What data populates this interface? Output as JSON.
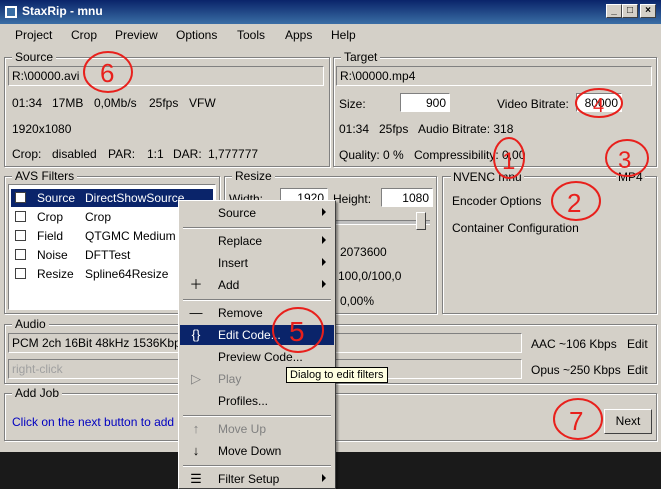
{
  "window": {
    "title": "StaxRip - mnu"
  },
  "menubar": {
    "items": [
      "Project",
      "Crop",
      "Preview",
      "Options",
      "Tools",
      "Apps",
      "Help"
    ]
  },
  "source": {
    "label": "Source",
    "path": "R:\\00000.avi",
    "info_line1": [
      "01:34",
      "17MB",
      "0,0Mb/s",
      "25fps",
      "VFW"
    ],
    "resolution": "1920x1080",
    "crop_label": "Crop:",
    "crop_value": "disabled",
    "par_label": "PAR:",
    "par_value": "1:1",
    "dar_label": "DAR:",
    "dar_value": "1,777777"
  },
  "target": {
    "label": "Target",
    "path": "R:\\00000.mp4",
    "size_label": "Size:",
    "size_value": "900",
    "video_bitrate_label": "Video Bitrate:",
    "video_bitrate_value": "80000",
    "duration": "01:34",
    "fps": "25fps",
    "audio_bitrate": "Audio Bitrate: 318",
    "quality": "Quality: 0 %",
    "compressibility": "Compressibility: 0,00"
  },
  "avs_filters": {
    "label": "AVS Filters",
    "rows": [
      {
        "category": "Source",
        "name": "DirectShowSource",
        "checked": true,
        "selected": true
      },
      {
        "category": "Crop",
        "name": "Crop",
        "checked": false,
        "selected": false
      },
      {
        "category": "Field",
        "name": "QTGMC Medium",
        "checked": false,
        "selected": false
      },
      {
        "category": "Noise",
        "name": "DFTTest",
        "checked": false,
        "selected": false
      },
      {
        "category": "Resize",
        "name": "Spline64Resize",
        "checked": false,
        "selected": false
      }
    ]
  },
  "resize": {
    "label": "Resize",
    "width_label": "Width:",
    "width_value": "1920",
    "height_label": "Height:",
    "height_value": "1080",
    "pixels": "2073600",
    "zoom": "100,0/100,0",
    "error": "0,00%"
  },
  "encoder": {
    "name": "NVENC mnu",
    "container": "MP4",
    "options_label": "Encoder Options",
    "container_config_label": "Container Configuration"
  },
  "audio": {
    "label": "Audio",
    "track1_value": "PCM 2ch 16Bit 48kHz 1536Kbps",
    "track1_codec": "AAC ~106 Kbps",
    "track1_edit": "Edit",
    "track2_placeholder": "right-click",
    "track2_codec": "Opus ~250 Kbps",
    "track2_edit": "Edit"
  },
  "add_job": {
    "label": "Add Job",
    "hint": "Click on the next button to add",
    "next_label": "Next"
  },
  "context_menu": {
    "items": {
      "source": "Source",
      "replace": "Replace",
      "insert": "Insert",
      "add": "Add",
      "remove": "Remove",
      "edit_code": "Edit Code...",
      "preview_code": "Preview Code...",
      "play": "Play",
      "profiles": "Profiles...",
      "move_up": "Move Up",
      "move_down": "Move Down",
      "filter_setup": "Filter Setup"
    }
  },
  "tooltip": {
    "text": "Dialog to edit filters"
  },
  "annotations": [
    "1",
    "2",
    "3",
    "4",
    "5",
    "6",
    "7"
  ],
  "colors": {
    "titlebar": "#0a246a",
    "selection": "#0a246a",
    "annotation": "#e8201c",
    "tooltip": "#ffffe1",
    "link_text": "#0000c0"
  }
}
